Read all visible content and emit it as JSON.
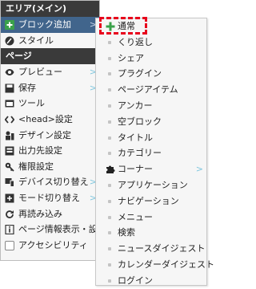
{
  "colors": {
    "header_bg": "#3a3a3a",
    "active_bg": "#41658c",
    "menu_bg": "#f6f6f6",
    "arrow": "#7fc6de",
    "plus_green": "#3aa14a",
    "highlight_red": "#e8001c"
  },
  "menu": {
    "section_area": "エリア(メイン)",
    "area_items": [
      {
        "label": "ブロック追加",
        "icon": "plus-icon",
        "arrow": ">"
      },
      {
        "label": "スタイル",
        "icon": "brush-icon"
      }
    ],
    "section_page": "ページ",
    "page_items": [
      {
        "label": "プレビュー",
        "icon": "eye-icon",
        "arrow": ">"
      },
      {
        "label": "保存",
        "icon": "save-icon",
        "arrow": ">"
      },
      {
        "label": "ツール",
        "icon": "tool-icon"
      },
      {
        "label": "<head>設定",
        "icon": "code-icon"
      },
      {
        "label": "デザイン設定",
        "icon": "design-icon"
      },
      {
        "label": "出力先設定",
        "icon": "output-icon"
      },
      {
        "label": "権限設定",
        "icon": "key-icon"
      },
      {
        "label": "デバイス切り替え",
        "icon": "device-icon",
        "arrow": ">"
      },
      {
        "label": "モード切り替え",
        "icon": "mode-icon",
        "arrow": ">"
      },
      {
        "label": "再読み込み",
        "icon": "reload-icon"
      },
      {
        "label": "ページ情報表示・設定",
        "icon": "info-icon"
      },
      {
        "label": "アクセシビリティ",
        "icon": "checkbox-icon"
      }
    ]
  },
  "submenu": {
    "items": [
      {
        "label": "通常",
        "icon": "plus-icon"
      },
      {
        "label": "くり返し"
      },
      {
        "label": "シェア"
      },
      {
        "label": "プラグイン"
      },
      {
        "label": "ページアイテム"
      },
      {
        "label": "アンカー"
      },
      {
        "label": "空ブロック"
      },
      {
        "label": "タイトル"
      },
      {
        "label": "カテゴリー"
      },
      {
        "label": "コーナー",
        "icon": "puzzle-icon",
        "arrow": ">"
      },
      {
        "label": "アプリケーション"
      },
      {
        "label": "ナビゲーション"
      },
      {
        "label": "メニュー"
      },
      {
        "label": "検索"
      },
      {
        "label": "ニュースダイジェスト"
      },
      {
        "label": "カレンダーダイジェスト"
      },
      {
        "label": "ログイン"
      }
    ]
  }
}
